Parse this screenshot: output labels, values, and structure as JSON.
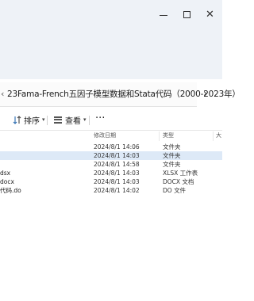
{
  "address": {
    "path": "23Fama-French五因子模型数据和Stata代码（2000-2023年）",
    "lead_chevron": "‹",
    "next_chevron": "›"
  },
  "commandbar": {
    "sort_label": "排序",
    "view_label": "查看",
    "more_label": "···"
  },
  "columns": {
    "date": "修改日期",
    "type": "类型",
    "size": "大"
  },
  "files": [
    {
      "name": "",
      "date": "2024/8/1 14:06",
      "type": "文件夹",
      "selected": false
    },
    {
      "name": "",
      "date": "2024/8/1 14:03",
      "type": "文件夹",
      "selected": true
    },
    {
      "name": "",
      "date": "2024/8/1 14:58",
      "type": "文件夹",
      "selected": false
    },
    {
      "name": "dsx",
      "date": "2024/8/1 14:03",
      "type": "XLSX 工作表",
      "selected": false
    },
    {
      "name": "docx",
      "date": "2024/8/1 14:03",
      "type": "DOCX 文档",
      "selected": false
    },
    {
      "name": "代码.do",
      "date": "2024/8/1 14:02",
      "type": "DO 文件",
      "selected": false
    }
  ]
}
